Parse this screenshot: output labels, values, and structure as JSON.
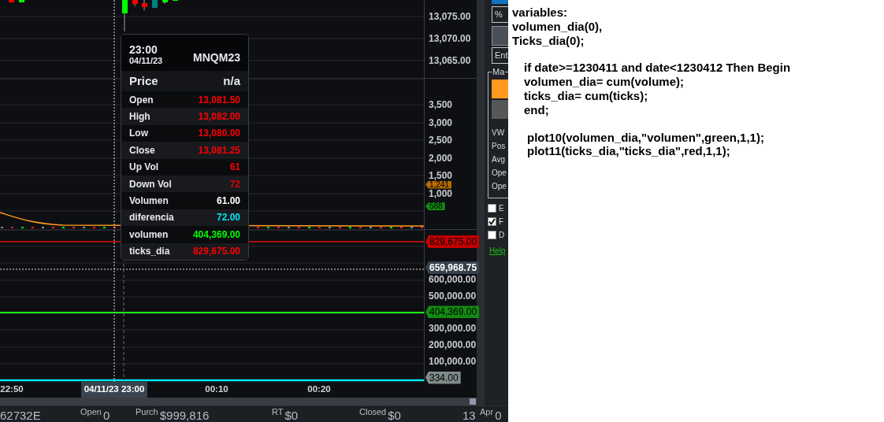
{
  "chart": {
    "price_axis": {
      "ticks": [
        "13,075.00",
        "13,070.00",
        "13,065.00"
      ]
    },
    "volume_axis": {
      "ticks": [
        "3,500",
        "3,000",
        "2,500",
        "2,000",
        "1,500",
        "1,000"
      ],
      "markers": [
        {
          "value": "1,241",
          "color": "#b36b00"
        },
        {
          "value": "588",
          "color": "#138a13"
        }
      ]
    },
    "ticks_axis": {
      "items": [
        {
          "kind": "tick",
          "value": "600,000.00"
        },
        {
          "kind": "tick",
          "value": "500,000.00"
        },
        {
          "kind": "marker",
          "value": "404,369.00",
          "color": "#138a13"
        },
        {
          "kind": "tick",
          "value": "300,000.00"
        },
        {
          "kind": "tick",
          "value": "200,000.00"
        },
        {
          "kind": "tick",
          "value": "100,000.00"
        },
        {
          "kind": "marker",
          "value": "334.00",
          "color": "#7f8b89"
        }
      ],
      "overlays": [
        {
          "kind": "marker",
          "value": "829,675.00",
          "color": "#c40000"
        },
        {
          "kind": "cursor",
          "value": "659,968.75",
          "color": "#37424c"
        }
      ]
    },
    "time_axis": [
      {
        "kind": "tick",
        "label": "22:50"
      },
      {
        "kind": "cursor",
        "label": "04/11/23 23:00"
      },
      {
        "kind": "tick",
        "label": "00:10"
      },
      {
        "kind": "tick",
        "label": "00:20"
      }
    ],
    "tooltip": {
      "time": "23:00",
      "date": "04/11/23",
      "symbol": "MNQM23",
      "header_label": "Price",
      "header_value": "n/a",
      "rows": [
        {
          "label": "Open",
          "value": "13,081.50",
          "color": "#ff0000"
        },
        {
          "label": "High",
          "value": "13,082.00",
          "color": "#ff0000"
        },
        {
          "label": "Low",
          "value": "13,080.00",
          "color": "#ff0000"
        },
        {
          "label": "Close",
          "value": "13,081.25",
          "color": "#ff0000"
        },
        {
          "label": "Up Vol",
          "value": "61",
          "color": "#ff0000"
        },
        {
          "label": "Down Vol",
          "value": "72",
          "color": "#e00000"
        },
        {
          "label": "Volumen",
          "value": "61.00",
          "color": "#ffffff"
        },
        {
          "label": "diferencia",
          "value": "72.00",
          "color": "#00e5f0"
        },
        {
          "label": "volumen",
          "value": "404,369.00",
          "color": "#00ff00"
        },
        {
          "label": "ticks_dia",
          "value": "829,675.00",
          "color": "#ff0000"
        }
      ]
    }
  },
  "side_panel": {
    "top": [
      {
        "kind": "bar"
      },
      {
        "kind": "field",
        "text": "%"
      },
      {
        "kind": "button"
      },
      {
        "kind": "field",
        "text": "Ent"
      }
    ],
    "group": {
      "legend": "Ma",
      "buttons": [
        {
          "kind": "accent"
        },
        {
          "kind": "plain"
        }
      ],
      "labels": [
        "VW",
        "Pos",
        "Avg",
        "Ope",
        "Ope"
      ]
    },
    "checkboxes": [
      {
        "label": "E",
        "checked": false
      },
      {
        "label": "F",
        "checked": true
      },
      {
        "label": "D",
        "checked": false
      }
    ],
    "link": "Help"
  },
  "status_bar": [
    {
      "value": "62732E"
    },
    {
      "label": "Open",
      "value": "0"
    },
    {
      "label": "Purch",
      "value": "$999,816"
    },
    {
      "label": "RT",
      "value": "$0"
    },
    {
      "label": "Closed",
      "value": "$0"
    },
    {
      "value": "13"
    },
    {
      "label": "Apr",
      "value": "0"
    }
  ],
  "code": [
    {
      "kind": "declarations",
      "lines": [
        "variables:",
        "volumen_dia(0),",
        "Ticks_dia(0);"
      ]
    },
    {
      "kind": "block",
      "lines": [
        "if date>=1230411 and date<1230412 Then Begin",
        "volumen_dia= cum(volume);",
        "ticks_dia= cum(ticks);",
        "end;"
      ]
    },
    {
      "kind": "plots",
      "lines": [
        "plot10(volumen_dia,\"volumen\",green,1,1);",
        "plot11(ticks_dia,\"ticks_dia\",red,1,1);"
      ]
    }
  ]
}
